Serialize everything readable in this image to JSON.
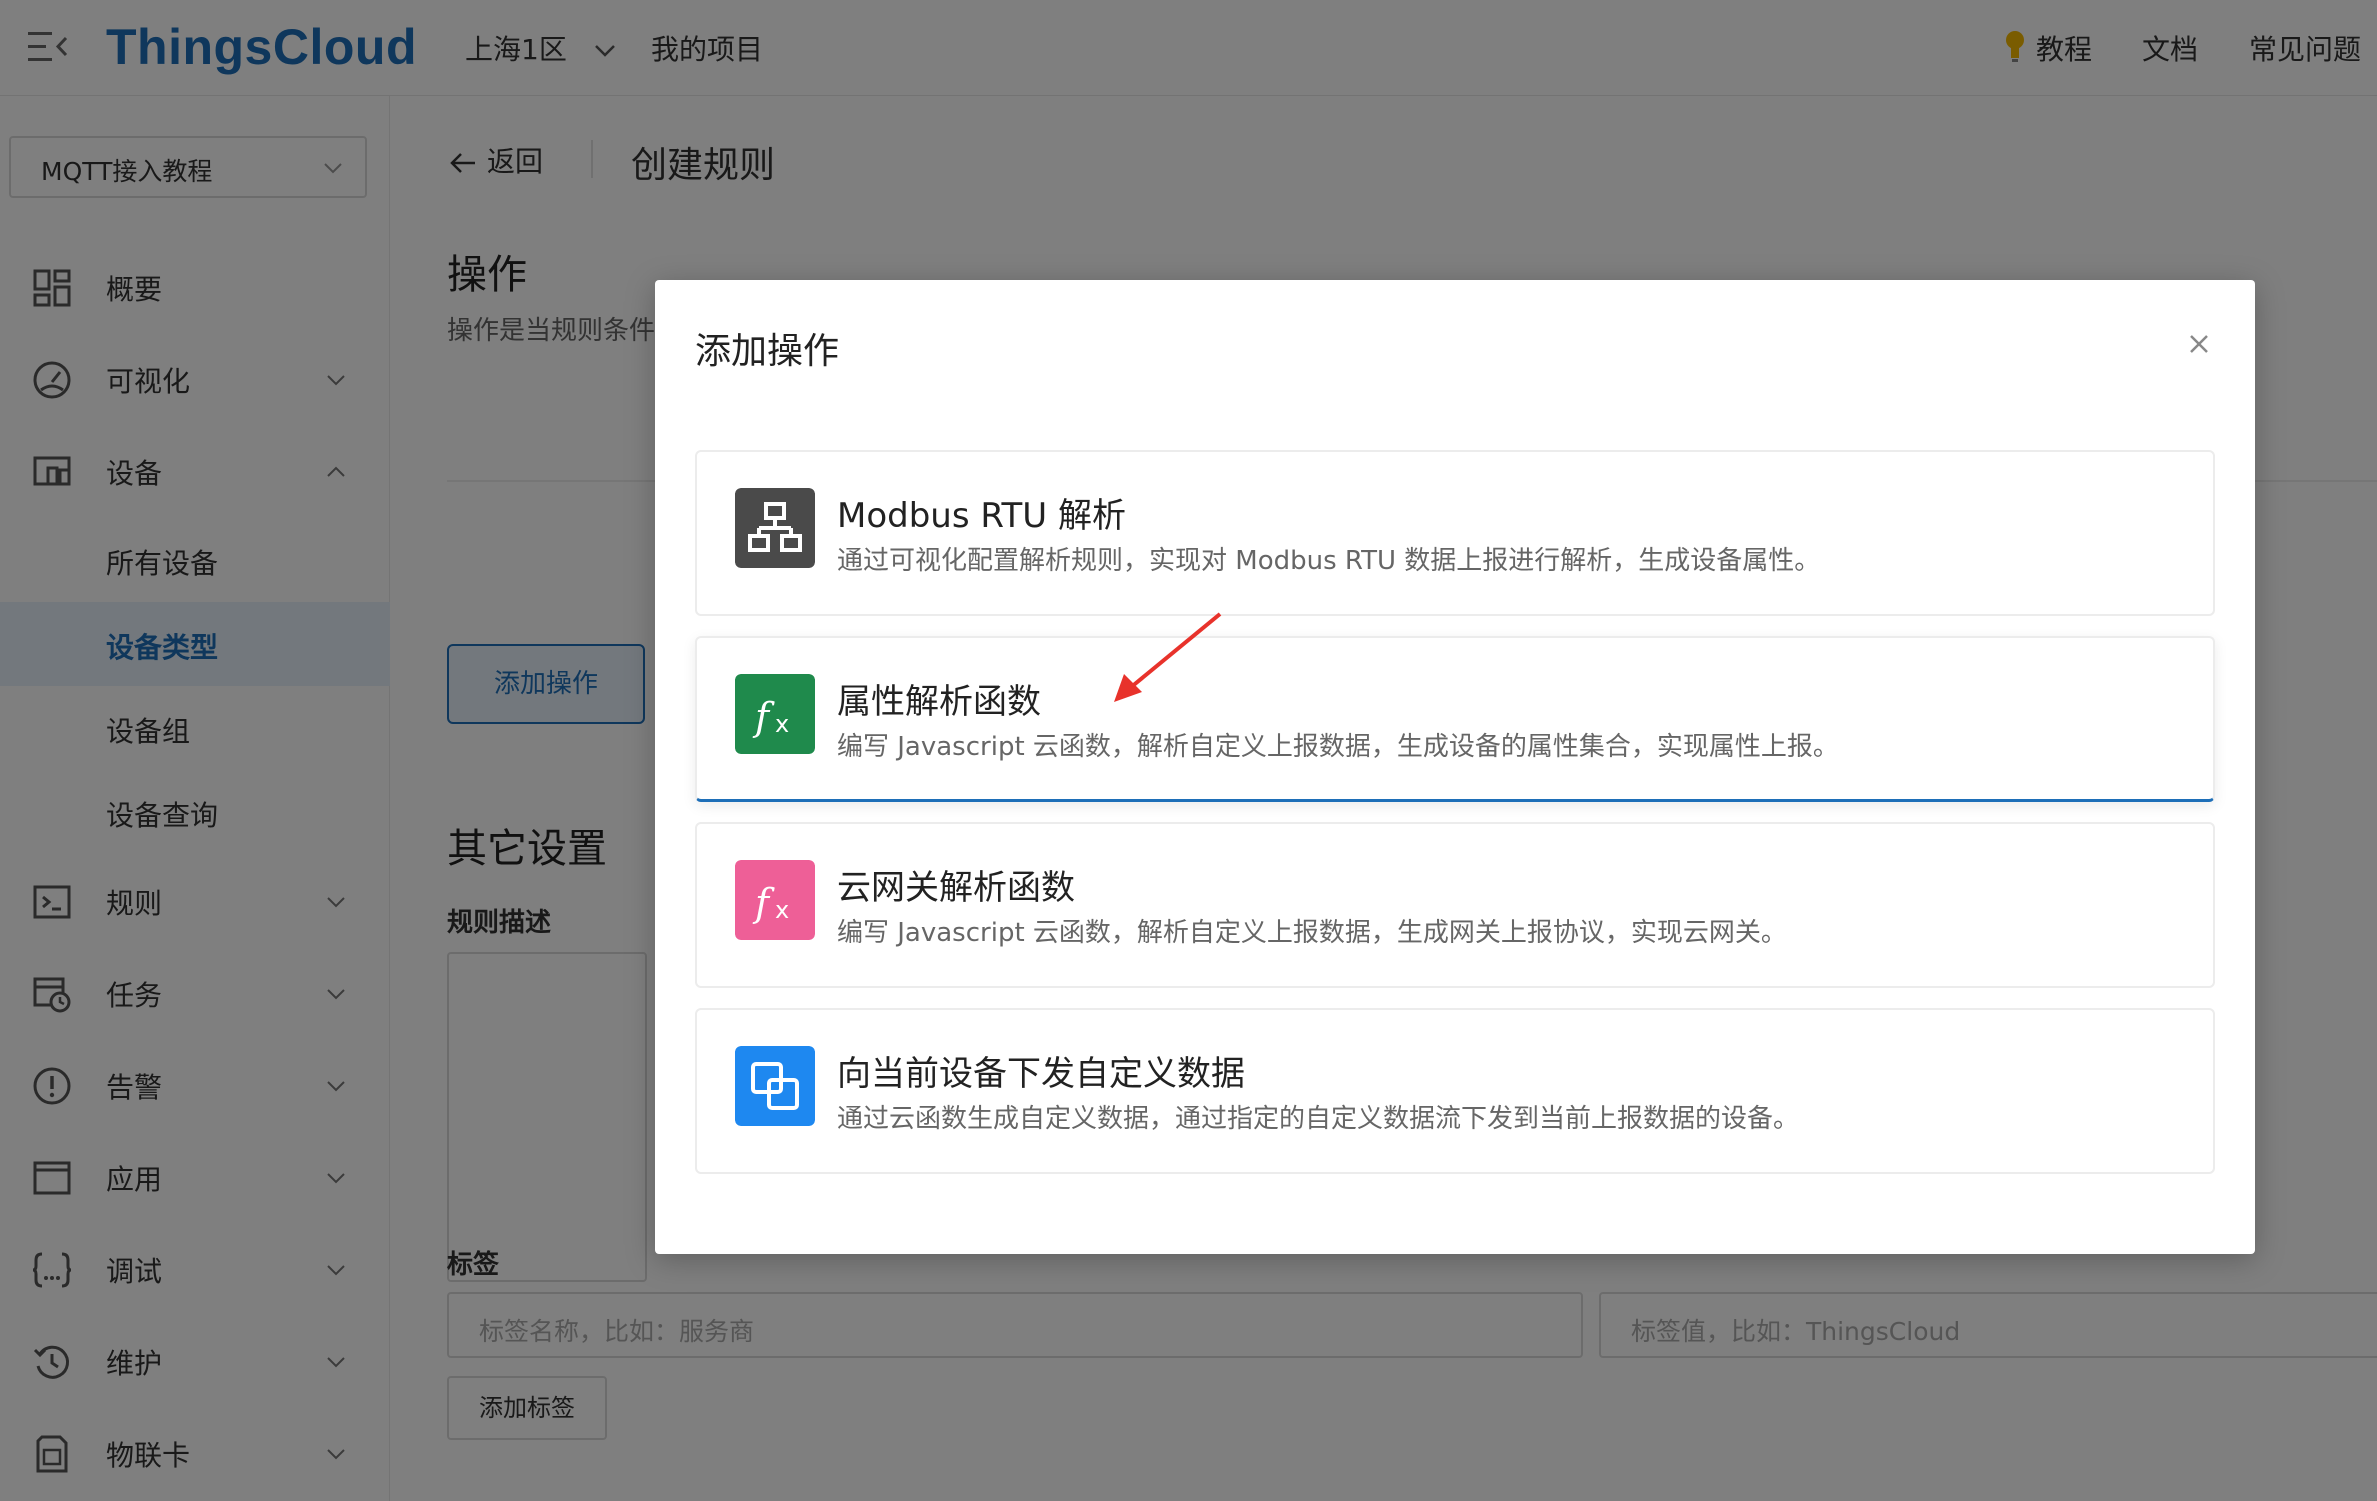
{
  "header": {
    "logo": "ThingsCloud",
    "region": "上海1区",
    "my_projects": "我的项目",
    "tutorial": "教程",
    "docs": "文档",
    "faq": "常见问题"
  },
  "sidebar": {
    "project": "MQTT接入教程",
    "items": {
      "overview": "概要",
      "visualize": "可视化",
      "devices": "设备",
      "all_devices": "所有设备",
      "device_types": "设备类型",
      "device_groups": "设备组",
      "device_query": "设备查询",
      "rules": "规则",
      "tasks": "任务",
      "alarms": "告警",
      "apps": "应用",
      "debug": "调试",
      "maintenance": "维护",
      "iot_card": "物联卡"
    }
  },
  "main": {
    "back": "返回",
    "title": "创建规则",
    "operations_heading": "操作",
    "operations_desc": "操作是当规则条件",
    "add_operation_button": "添加操作",
    "other_settings_heading": "其它设置",
    "rule_desc_label": "规则描述",
    "tags_label": "标签",
    "tag_name_placeholder": "标签名称，比如：服务商",
    "tag_value_placeholder": "标签值，比如：ThingsCloud",
    "add_tag_button": "添加标签"
  },
  "modal": {
    "title": "添加操作",
    "options": [
      {
        "title": "Modbus RTU 解析",
        "desc": "通过可视化配置解析规则，实现对 Modbus RTU 数据上报进行解析，生成设备属性。",
        "color": "#4a4a4a",
        "icon": "network-icon"
      },
      {
        "title": "属性解析函数",
        "desc": "编写 Javascript 云函数，解析自定义上报数据，生成设备的属性集合，实现属性上报。",
        "color": "#1f8a4c",
        "icon": "function-icon"
      },
      {
        "title": "云网关解析函数",
        "desc": "编写 Javascript 云函数，解析自定义上报数据，生成网关上报协议，实现云网关。",
        "color": "#ee5f97",
        "icon": "function-icon"
      },
      {
        "title": "向当前设备下发自定义数据",
        "desc": "通过云函数生成自定义数据，通过指定的自定义数据流下发到当前上报数据的设备。",
        "color": "#1e88f0",
        "icon": "copy-icon"
      }
    ]
  }
}
